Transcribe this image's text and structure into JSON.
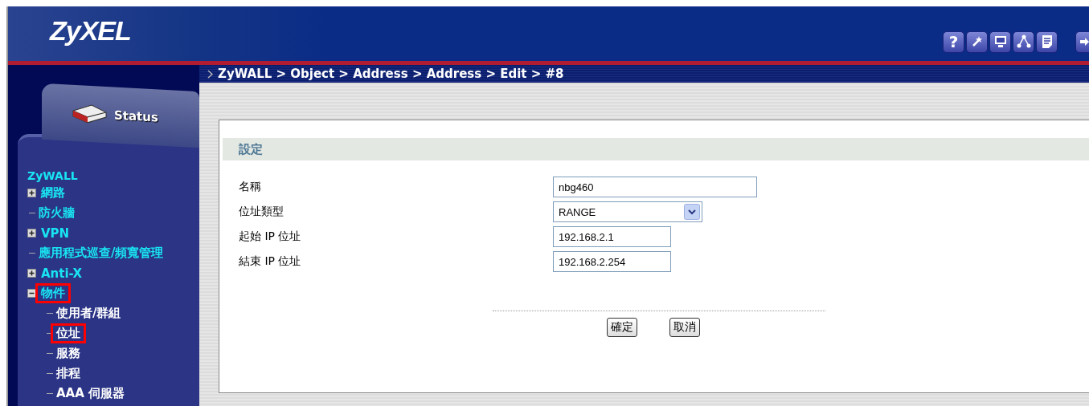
{
  "header": {
    "logo": "ZyXEL",
    "toolbar": [
      {
        "kind": "help",
        "label": "?"
      },
      {
        "kind": "wizard"
      },
      {
        "kind": "console"
      },
      {
        "kind": "network"
      },
      {
        "kind": "log"
      },
      {
        "kind": "logout"
      }
    ]
  },
  "sidebar": {
    "status_tab": "Status",
    "tree_title": "ZyWALL",
    "items": [
      {
        "label": "網路",
        "kind": "folder",
        "expanded": false,
        "highlighted": false
      },
      {
        "label": "防火牆",
        "kind": "leaf",
        "highlighted": false
      },
      {
        "label": "VPN",
        "kind": "folder",
        "expanded": false,
        "highlighted": false
      },
      {
        "label": "應用程式巡查/頻寬管理",
        "kind": "leaf",
        "highlighted": false
      },
      {
        "label": "Anti-X",
        "kind": "folder",
        "expanded": false,
        "highlighted": false
      },
      {
        "label": "物件",
        "kind": "folder",
        "expanded": true,
        "highlighted": true,
        "children": [
          {
            "label": "使用者/群組",
            "highlighted": false
          },
          {
            "label": "位址",
            "highlighted": true
          },
          {
            "label": "服務",
            "highlighted": false
          },
          {
            "label": "排程",
            "highlighted": false
          },
          {
            "label": "AAA 伺服器",
            "highlighted": false
          }
        ]
      }
    ]
  },
  "breadcrumb": "ZyWALL > Object > Address > Address > Edit > #8",
  "panel": {
    "section_title": "設定",
    "fields": [
      {
        "label": "名稱",
        "kind": "text",
        "value": "nbg460"
      },
      {
        "label": "位址類型",
        "kind": "select",
        "value": "RANGE"
      },
      {
        "label": "起始 IP 位址",
        "kind": "address",
        "value": "192.168.2.1"
      },
      {
        "label": "結束 IP 位址",
        "kind": "address",
        "value": "192.168.2.254"
      }
    ],
    "buttons": [
      "確定",
      "取消"
    ]
  }
}
